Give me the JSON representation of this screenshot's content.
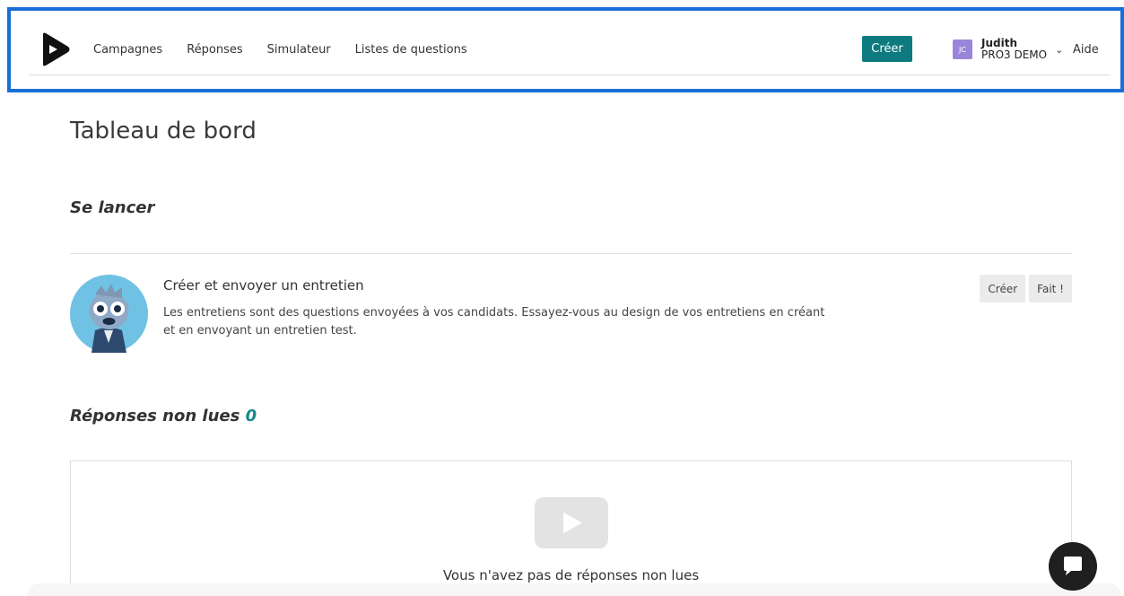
{
  "nav": {
    "items": [
      "Campagnes",
      "Réponses",
      "Simulateur",
      "Listes de questions"
    ],
    "create_label": "Créer",
    "user": {
      "initials": "JC",
      "name": "Judith",
      "org": "PRO3 DEMO"
    },
    "help_label": "Aide"
  },
  "page": {
    "title": "Tableau de bord"
  },
  "getting_started": {
    "title": "Se lancer",
    "task": {
      "title": "Créer et envoyer un entretien",
      "description": "Les entretiens sont des questions envoyées à vos candidats. Essayez-vous au design de vos entretiens en créant et en envoyant un entretien test.",
      "create_label": "Créer",
      "done_label": "Fait !"
    }
  },
  "unread": {
    "title": "Réponses non lues",
    "count": "0",
    "empty_message": "Vous n'avez pas de réponses non lues"
  },
  "colors": {
    "accent": "#0d7a80",
    "header_border": "#1a6ed8",
    "avatar": "#9a86d8"
  }
}
